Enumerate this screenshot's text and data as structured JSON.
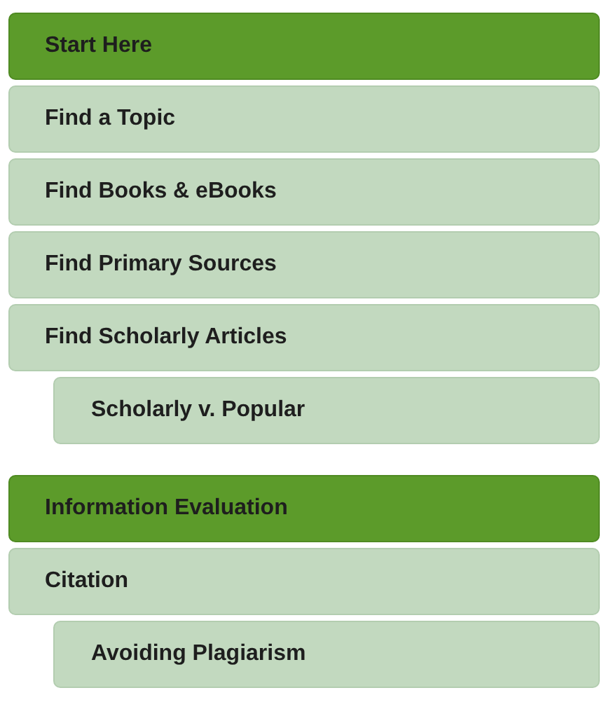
{
  "groups": [
    {
      "items": [
        {
          "label": "Start Here",
          "selected": true
        },
        {
          "label": "Find a Topic",
          "selected": false
        },
        {
          "label": "Find Books & eBooks",
          "selected": false
        },
        {
          "label": "Find Primary Sources",
          "selected": false
        },
        {
          "label": "Find Scholarly Articles",
          "selected": false,
          "children": [
            {
              "label": "Scholarly v. Popular",
              "selected": false
            }
          ]
        }
      ]
    },
    {
      "items": [
        {
          "label": "Information Evaluation",
          "selected": true
        },
        {
          "label": "Citation",
          "selected": false,
          "children": [
            {
              "label": "Avoiding Plagiarism",
              "selected": false
            }
          ]
        }
      ]
    }
  ]
}
